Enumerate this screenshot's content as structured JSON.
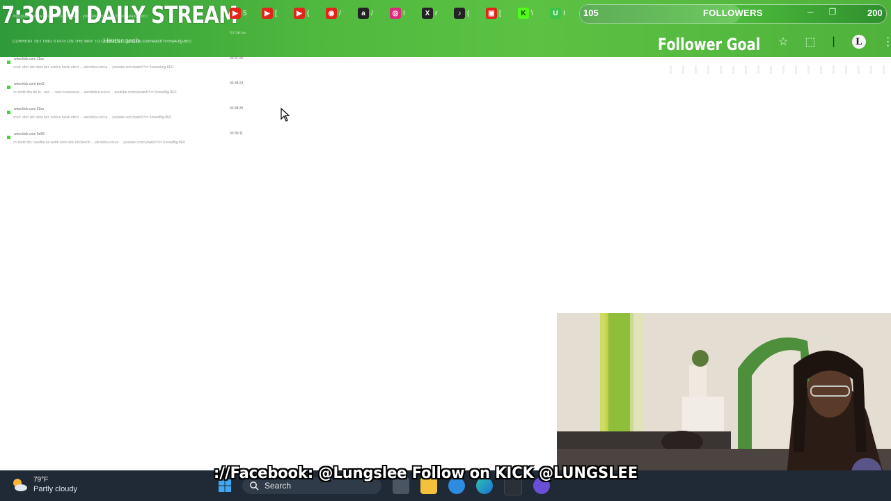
{
  "overlay": {
    "stream_title": "7:30PM DAILY STREAM",
    "followers": {
      "current": "105",
      "label": "FOLLOWERS",
      "target": "200",
      "progress_fraction": 0.525
    },
    "goal_title": "Follower Goal",
    "ticker": "://Facebook: @Lungslee Follow on KICK @LUNGSLEE"
  },
  "tabs": [
    {
      "icon": "youtube-icon",
      "glyph": "▶",
      "suffix": "5",
      "color": "#e2241b"
    },
    {
      "icon": "youtube-icon",
      "glyph": "▶",
      "suffix": "[",
      "color": "#e2241b"
    },
    {
      "icon": "youtube-icon",
      "glyph": "▶",
      "suffix": "(",
      "color": "#e2241b"
    },
    {
      "icon": "broadcast-icon",
      "glyph": "◉",
      "suffix": "/",
      "color": "#e2241b"
    },
    {
      "icon": "amazon-icon",
      "glyph": "a",
      "suffix": "/",
      "color": "#222222"
    },
    {
      "icon": "instagram-icon",
      "glyph": "◎",
      "suffix": "I",
      "color": "#dd2a7b"
    },
    {
      "icon": "x-icon",
      "glyph": "X",
      "suffix": "r",
      "color": "#222222"
    },
    {
      "icon": "tiktok-icon",
      "glyph": "♪",
      "suffix": "(",
      "color": "#222222"
    },
    {
      "icon": "studio-icon",
      "glyph": "▣",
      "suffix": "[",
      "color": "#e2241b"
    },
    {
      "icon": "kick-icon",
      "glyph": "K",
      "suffix": "\\",
      "color": "#53fc18"
    },
    {
      "icon": "u-icon",
      "glyph": "U",
      "suffix": "I",
      "color": "#3ec24a"
    }
  ],
  "browser": {
    "search_placeholder": "Hintsearch",
    "faint_url": "CURRENT SETTING STATS ON THE WAY TO COMMENT · youtube.com/watch?v=5w4Jfg-8E0",
    "faint_url_top": "#lungslee follow · kick.com/lungslee · youtube.com/watch?v=5w4Jfg-8E0",
    "faint_time": "03:36:55"
  },
  "chat_rows": [
    {
      "user": "www.kick.com 11ss",
      "message": "ccsd: abcl abc dest tarc actrice heick ebccl ... wkcbdca.cocca ... youtube.cocc/watch?v= 5owwsbcg-8E0",
      "time": "03:37:25"
    },
    {
      "user": "www.kick.com bes3",
      "message": "cc ebdd dbu tfe Ie...reel ... ceev cceecesce ... wecbhdca.cocca ... youtube.ccmcs/watch?v= 5owwt8ig-8E0",
      "time": "03:38:23"
    },
    {
      "user": "www.kick.com 03ss",
      "message": "ccsd: abcl abc dest tarc actrice heick ebccl ... wkcbdca.cocca ... youtube.cocc/watch?v= 5owwt8ig-8E0",
      "time": "03:38:35"
    },
    {
      "user": "www.kick.com 5e83",
      "message": "cc ebdd dbc cwedbe ke webb bsed ebc ebcdeecb ... wkcbdca.cocca ... youtube.ccmcs/watch?v= 5owwt8ig-8E0",
      "time": "03:39:11"
    }
  ],
  "taskbar": {
    "weather": {
      "temp": "79°F",
      "condition": "Partly cloudy"
    },
    "search_label": "Search"
  },
  "colors": {
    "accent_green": "#4fb83e",
    "kick_green": "#53fc18",
    "taskbar": "#1f2a36"
  }
}
